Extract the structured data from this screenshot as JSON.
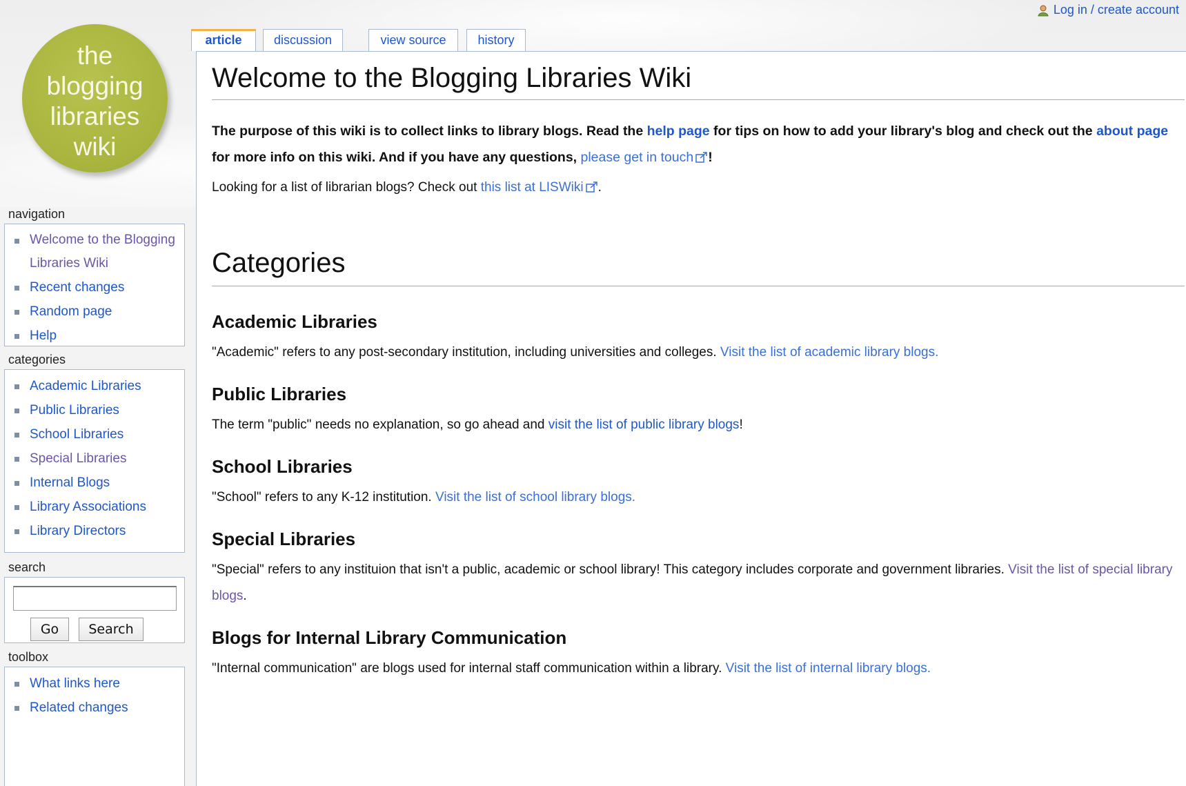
{
  "userbar": {
    "login": "Log in / create account"
  },
  "logo": {
    "lines": [
      "the",
      "blogging",
      "libraries",
      "wiki"
    ]
  },
  "tabs": [
    {
      "label": "article"
    },
    {
      "label": "discussion"
    },
    {
      "label": "view source"
    },
    {
      "label": "history"
    }
  ],
  "page": {
    "title": "Welcome to the Blogging Libraries Wiki",
    "intro": {
      "t1": "The purpose of this wiki is to collect links to library blogs. Read the ",
      "link1": "help page",
      "t2": " for tips on how to add your library's blog and check out the ",
      "link2": "about page",
      "t3": " for more info on this wiki. And if you have any questions, ",
      "link3": "please get in touch",
      "t4": "!"
    },
    "look": {
      "t1": "Looking for a list of librarian blogs? Check out ",
      "link": "this list at LISWiki",
      "t2": "."
    },
    "categories_heading": "Categories",
    "sections": [
      {
        "heading": "Academic Libraries",
        "text": "\"Academic\" refers to any post-secondary institution, including universities and colleges. ",
        "link": "Visit the list of academic library blogs.",
        "after": ""
      },
      {
        "heading": "Public Libraries",
        "text": "The term \"public\" needs no explanation, so go ahead and ",
        "link": "visit the list of public library blogs",
        "after": "!"
      },
      {
        "heading": "School Libraries",
        "text": "\"School\" refers to any K-12 institution. ",
        "link": "Visit the list of school library blogs.",
        "after": ""
      },
      {
        "heading": "Special Libraries",
        "text": "\"Special\" refers to any instituion that isn't a public, academic or school library! This category includes corporate and government libraries. ",
        "link": "Visit the list of special library blogs",
        "after": "."
      },
      {
        "heading": "Blogs for Internal Library Communication",
        "text": "\"Internal communication\" are blogs used for internal staff communication within a library. ",
        "link": "Visit the list of internal library blogs.",
        "after": ""
      }
    ]
  },
  "sidebar": {
    "navigation": {
      "title": "navigation",
      "items": [
        "Welcome to the Blogging Libraries Wiki",
        "Recent changes",
        "Random page",
        "Help"
      ]
    },
    "categories": {
      "title": "categories",
      "items": [
        "Academic Libraries",
        "Public Libraries",
        "School Libraries",
        "Special Libraries",
        "Internal Blogs",
        "Library Associations",
        "Library Directors"
      ]
    },
    "search": {
      "title": "search",
      "go": "Go",
      "search": "Search",
      "value": ""
    },
    "toolbox": {
      "title": "toolbox",
      "items": [
        "What links here",
        "Related changes"
      ]
    }
  }
}
